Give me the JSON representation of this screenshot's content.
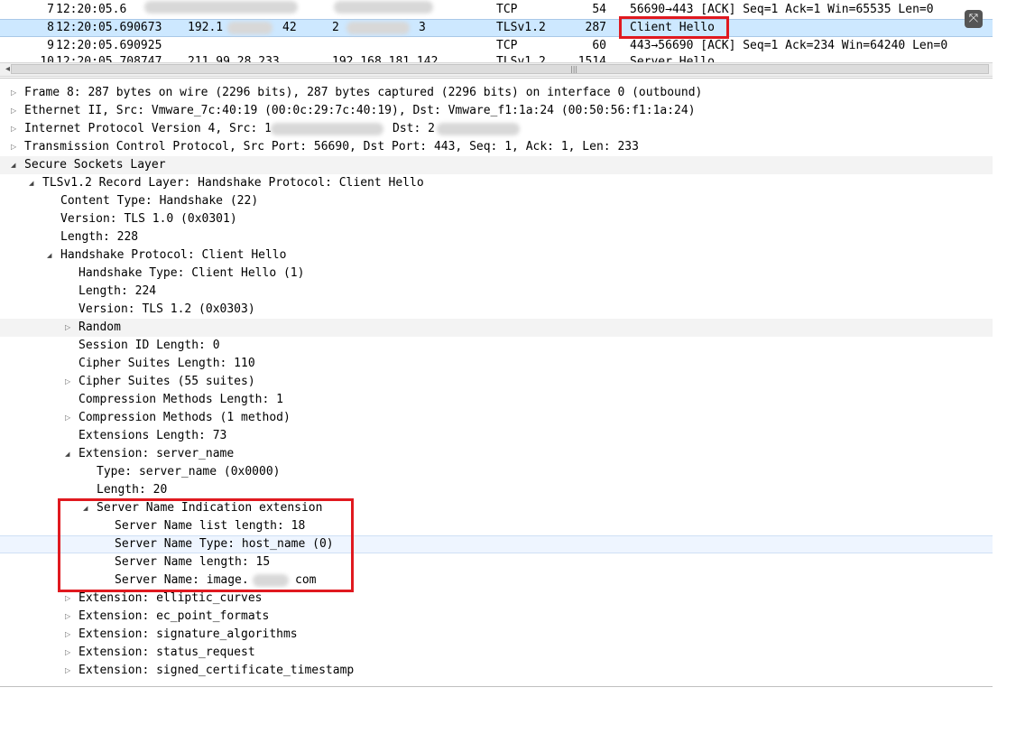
{
  "packets": [
    {
      "no": "7",
      "time": "12:20:05.6",
      "src": "",
      "dst": "",
      "proto": "TCP",
      "len": "54",
      "info": "56690→443 [ACK] Seq=1 Ack=1 Win=65535 Len=0"
    },
    {
      "no": "8",
      "time": "12:20:05.690673",
      "src": "192.1",
      "src_tail": "42",
      "dst": "2",
      "dst_tail": "3",
      "proto": "TLSv1.2",
      "len": "287",
      "info": "Client Hello"
    },
    {
      "no": "9",
      "time": "12:20:05.690925",
      "src": "",
      "dst": "",
      "proto": "TCP",
      "len": "60",
      "info": "443→56690 [ACK] Seq=1 Ack=234 Win=64240 Len=0"
    },
    {
      "no": "10",
      "time": "12:20:05.708747",
      "src": "211.99.28.233",
      "dst": "192.168.181.142",
      "proto": "TLSv1.2",
      "len": "1514",
      "info": "Server Hello"
    }
  ],
  "tree": [
    {
      "text": "Frame 8: 287 bytes on wire (2296 bits), 287 bytes captured (2296 bits) on interface 0 (outbound)",
      "twisty": "closed"
    },
    {
      "text": "Ethernet II, Src: Vmware_7c:40:19 (00:0c:29:7c:40:19), Dst: Vmware_f1:1a:24 (00:50:56:f1:1a:24)",
      "twisty": "closed"
    },
    {
      "text": "Internet Protocol Version 4, Src: 1",
      "text2": "Dst: 2",
      "twisty": "closed"
    },
    {
      "text": "Transmission Control Protocol, Src Port: 56690, Dst Port: 443, Seq: 1, Ack: 1, Len: 233",
      "twisty": "closed"
    },
    {
      "text": "Secure Sockets Layer",
      "twisty": "open"
    },
    {
      "text": "TLSv1.2 Record Layer: Handshake Protocol: Client Hello",
      "twisty": "open"
    },
    {
      "text": "Content Type: Handshake (22)",
      "twisty": "none"
    },
    {
      "text": "Version: TLS 1.0 (0x0301)",
      "twisty": "none"
    },
    {
      "text": "Length: 228",
      "twisty": "none"
    },
    {
      "text": "Handshake Protocol: Client Hello",
      "twisty": "open"
    },
    {
      "text": "Handshake Type: Client Hello (1)",
      "twisty": "none"
    },
    {
      "text": "Length: 224",
      "twisty": "none"
    },
    {
      "text": "Version: TLS 1.2 (0x0303)",
      "twisty": "none"
    },
    {
      "text": "Random",
      "twisty": "closed"
    },
    {
      "text": "Session ID Length: 0",
      "twisty": "none"
    },
    {
      "text": "Cipher Suites Length: 110",
      "twisty": "none"
    },
    {
      "text": "Cipher Suites (55 suites)",
      "twisty": "closed"
    },
    {
      "text": "Compression Methods Length: 1",
      "twisty": "none"
    },
    {
      "text": "Compression Methods (1 method)",
      "twisty": "closed"
    },
    {
      "text": "Extensions Length: 73",
      "twisty": "none"
    },
    {
      "text": "Extension: server_name",
      "twisty": "open"
    },
    {
      "text": "Type: server_name (0x0000)",
      "twisty": "none"
    },
    {
      "text": "Length: 20",
      "twisty": "none"
    },
    {
      "text": "Server Name Indication extension",
      "twisty": "open"
    },
    {
      "text": "Server Name list length: 18",
      "twisty": "none"
    },
    {
      "text": "Server Name Type: host_name (0)",
      "twisty": "none"
    },
    {
      "text": "Server Name length: 15",
      "twisty": "none"
    },
    {
      "text": "Server Name: image.",
      "text2": "com",
      "twisty": "none"
    },
    {
      "text": "Extension: elliptic_curves",
      "twisty": "closed"
    },
    {
      "text": "Extension: ec_point_formats",
      "twisty": "closed"
    },
    {
      "text": "Extension: signature_algorithms",
      "twisty": "closed"
    },
    {
      "text": "Extension: status_request",
      "twisty": "closed"
    },
    {
      "text": "Extension: signed_certificate_timestamp",
      "twisty": "closed"
    }
  ],
  "icons": {
    "expand": "expand-icon",
    "twisty_closed": "triangle-right-icon",
    "twisty_open": "triangle-down-icon"
  },
  "colors": {
    "highlight_box": "#e0191f",
    "selected_row": "#cde8ff"
  }
}
